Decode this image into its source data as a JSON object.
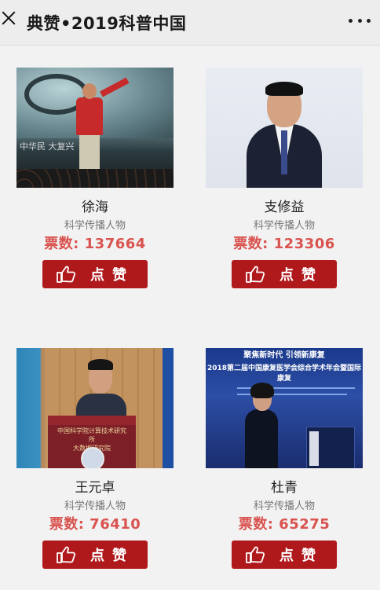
{
  "header": {
    "title": "典赞•2019科普中国"
  },
  "candidates": [
    {
      "name": "徐海",
      "role": "科学传播人物",
      "votes": "票数: 137664",
      "button_label": "点赞",
      "photo_slogan": "中华民     大复兴"
    },
    {
      "name": "支修益",
      "role": "科学传播人物",
      "votes": "票数: 123306",
      "button_label": "点赞"
    },
    {
      "name": "王元卓",
      "role": "科学传播人物",
      "votes": "票数: 76410",
      "button_label": "点赞",
      "photo_lectern_line1": "中国科学院计算技术研究所",
      "photo_lectern_line2": "大数据研究院"
    },
    {
      "name": "杜青",
      "role": "科学传播人物",
      "votes": "票数: 65275",
      "button_label": "点赞",
      "photo_banner_top": "聚焦新时代 引领新康复",
      "photo_banner_main": "2018第二届中国康复医学会综合学术年会暨国际康复"
    }
  ],
  "colors": {
    "accent": "#b0191c",
    "votes": "#d9534f"
  }
}
